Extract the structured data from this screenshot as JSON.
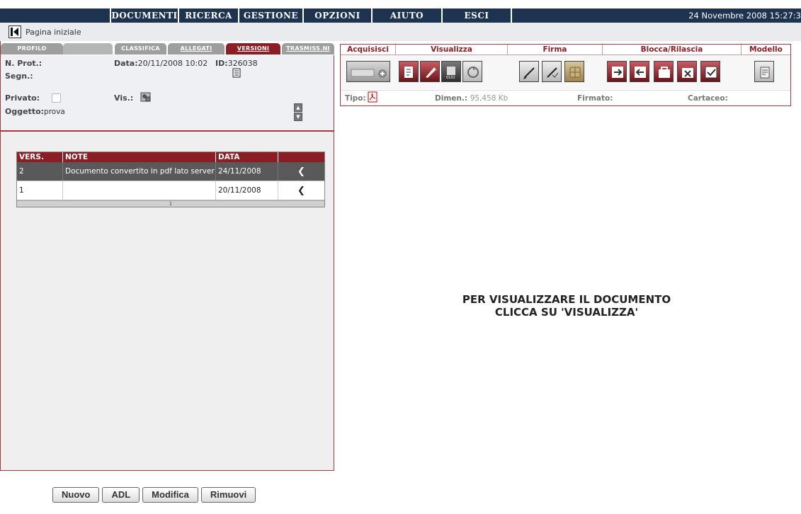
{
  "top_menu": {
    "items": [
      "DOCUMENTI",
      "RICERCA",
      "GESTIONE",
      "OPZIONI",
      "AIUTO",
      "ESCI"
    ],
    "datetime": "24 Novembre 2008 15:27:3"
  },
  "home": {
    "label": "Pagina iniziale",
    "icon": "back-arrow-icon"
  },
  "tabs": {
    "profilo": "PROFILO",
    "classifica": "CLASSIFICA",
    "allegati": "ALLEGATI",
    "versioni": "VERSIONI",
    "trasmissioni": "TRASMISS.NI"
  },
  "profile": {
    "n_prot_label": "N. Prot.:",
    "segn_label": "Segn.:",
    "data_label": "Data:",
    "data_value": "20/11/2008 10:02",
    "id_label": "ID:",
    "id_value": "326038",
    "privato_label": "Privato:",
    "vis_label": "Vis.:",
    "oggetto_label": "Oggetto:",
    "oggetto_value": "prova"
  },
  "versions_table": {
    "headers": [
      "VERS.",
      "NOTE",
      "DATA",
      ""
    ],
    "rows": [
      {
        "vers": "2",
        "note": "Documento convertito in pdf lato server",
        "data": "24/11/2008",
        "selected": true
      },
      {
        "vers": "1",
        "note": "",
        "data": "20/11/2008",
        "selected": false
      }
    ],
    "footer": "1"
  },
  "toolbar": {
    "groups": [
      "Acquisisci",
      "Visualizza",
      "Firma",
      "Blocca/Rilascia",
      "Modello"
    ]
  },
  "doc_info": {
    "tipo_label": "Tipo:",
    "dimen_label": "Dimen.:",
    "dimen_value": "95,458 Kb",
    "firmato_label": "Firmato:",
    "cartaceo_label": "Cartaceo:"
  },
  "message": {
    "line1": "PER VISUALIZZARE IL DOCUMENTO",
    "line2": "CLICCA SU 'VISUALIZZA'"
  },
  "buttons": {
    "nuovo": "Nuovo",
    "adl": "ADL",
    "modifica": "Modifica",
    "rimuovi": "Rimuovi"
  },
  "colors": {
    "menu_bg": "#1e3350",
    "accent": "#8c1d24",
    "panel_bg": "#efefef"
  }
}
